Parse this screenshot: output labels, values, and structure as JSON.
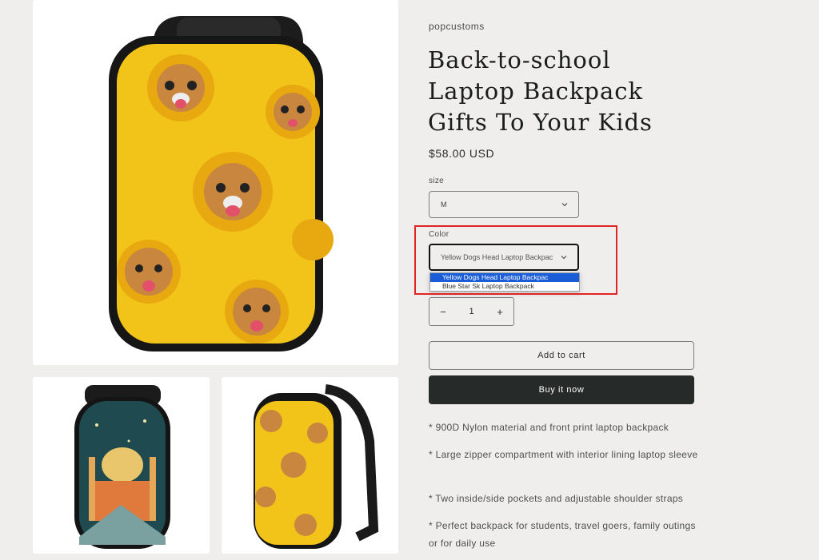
{
  "product": {
    "vendor": "popcustoms",
    "title": "Back-to-school Laptop Backpack Gifts To Your Kids",
    "price": "$58.00 USD"
  },
  "options": {
    "size_label": "size",
    "size_value": "M",
    "color_label": "Color",
    "color_value": "Yellow Dogs Head Laptop Backpac",
    "color_options": [
      "Yellow Dogs Head Laptop Backpac",
      "Blue Star Sk Laptop Backpack"
    ]
  },
  "quantity": {
    "value": "1",
    "minus": "−",
    "plus": "+"
  },
  "buttons": {
    "add_to_cart": "Add to cart",
    "buy_now": "Buy it now"
  },
  "description": [
    "* 900D Nylon material and front print laptop backpack",
    "* Large zipper compartment with interior lining laptop sleeve",
    "* Two inside/side pockets and adjustable shoulder straps",
    "* Perfect backpack for students, travel goers, family outings or for daily use"
  ],
  "colors": {
    "background": "#efeeec",
    "accent_dark": "#262b29",
    "highlight": "#e12525",
    "select_blue": "#1a5dd6",
    "backpack_yellow": "#f2c318"
  }
}
